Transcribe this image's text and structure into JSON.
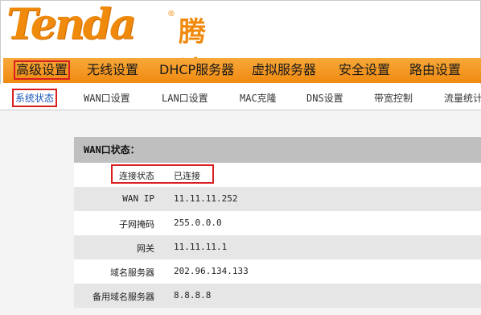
{
  "logo": {
    "latin": "Tenda",
    "reg": "®",
    "cjk": "腾达"
  },
  "main_nav": [
    {
      "label": "高级设置"
    },
    {
      "label": "无线设置"
    },
    {
      "label": "DHCP服务器"
    },
    {
      "label": "虚拟服务器"
    },
    {
      "label": "安全设置"
    },
    {
      "label": "路由设置"
    }
  ],
  "sub_nav": [
    {
      "label": "系统状态"
    },
    {
      "label": "WAN口设置"
    },
    {
      "label": "LAN口设置"
    },
    {
      "label": "MAC克隆"
    },
    {
      "label": "DNS设置"
    },
    {
      "label": "带宽控制"
    },
    {
      "label": "流量统计"
    }
  ],
  "wan_status": {
    "title": "WAN口状态：",
    "rows": [
      {
        "label": "连接状态",
        "value": "已连接"
      },
      {
        "label": "WAN IP",
        "value": "11.11.11.252"
      },
      {
        "label": "子网掩码",
        "value": "255.0.0.0"
      },
      {
        "label": "网关",
        "value": "11.11.11.1"
      },
      {
        "label": "域名服务器",
        "value": "202.96.134.133"
      },
      {
        "label": "备用域名服务器",
        "value": "8.8.8.8"
      }
    ]
  },
  "colors": {
    "brand_orange": "#f08a0c",
    "highlight_red": "#d81e1e",
    "active_link": "#1a56b8"
  }
}
